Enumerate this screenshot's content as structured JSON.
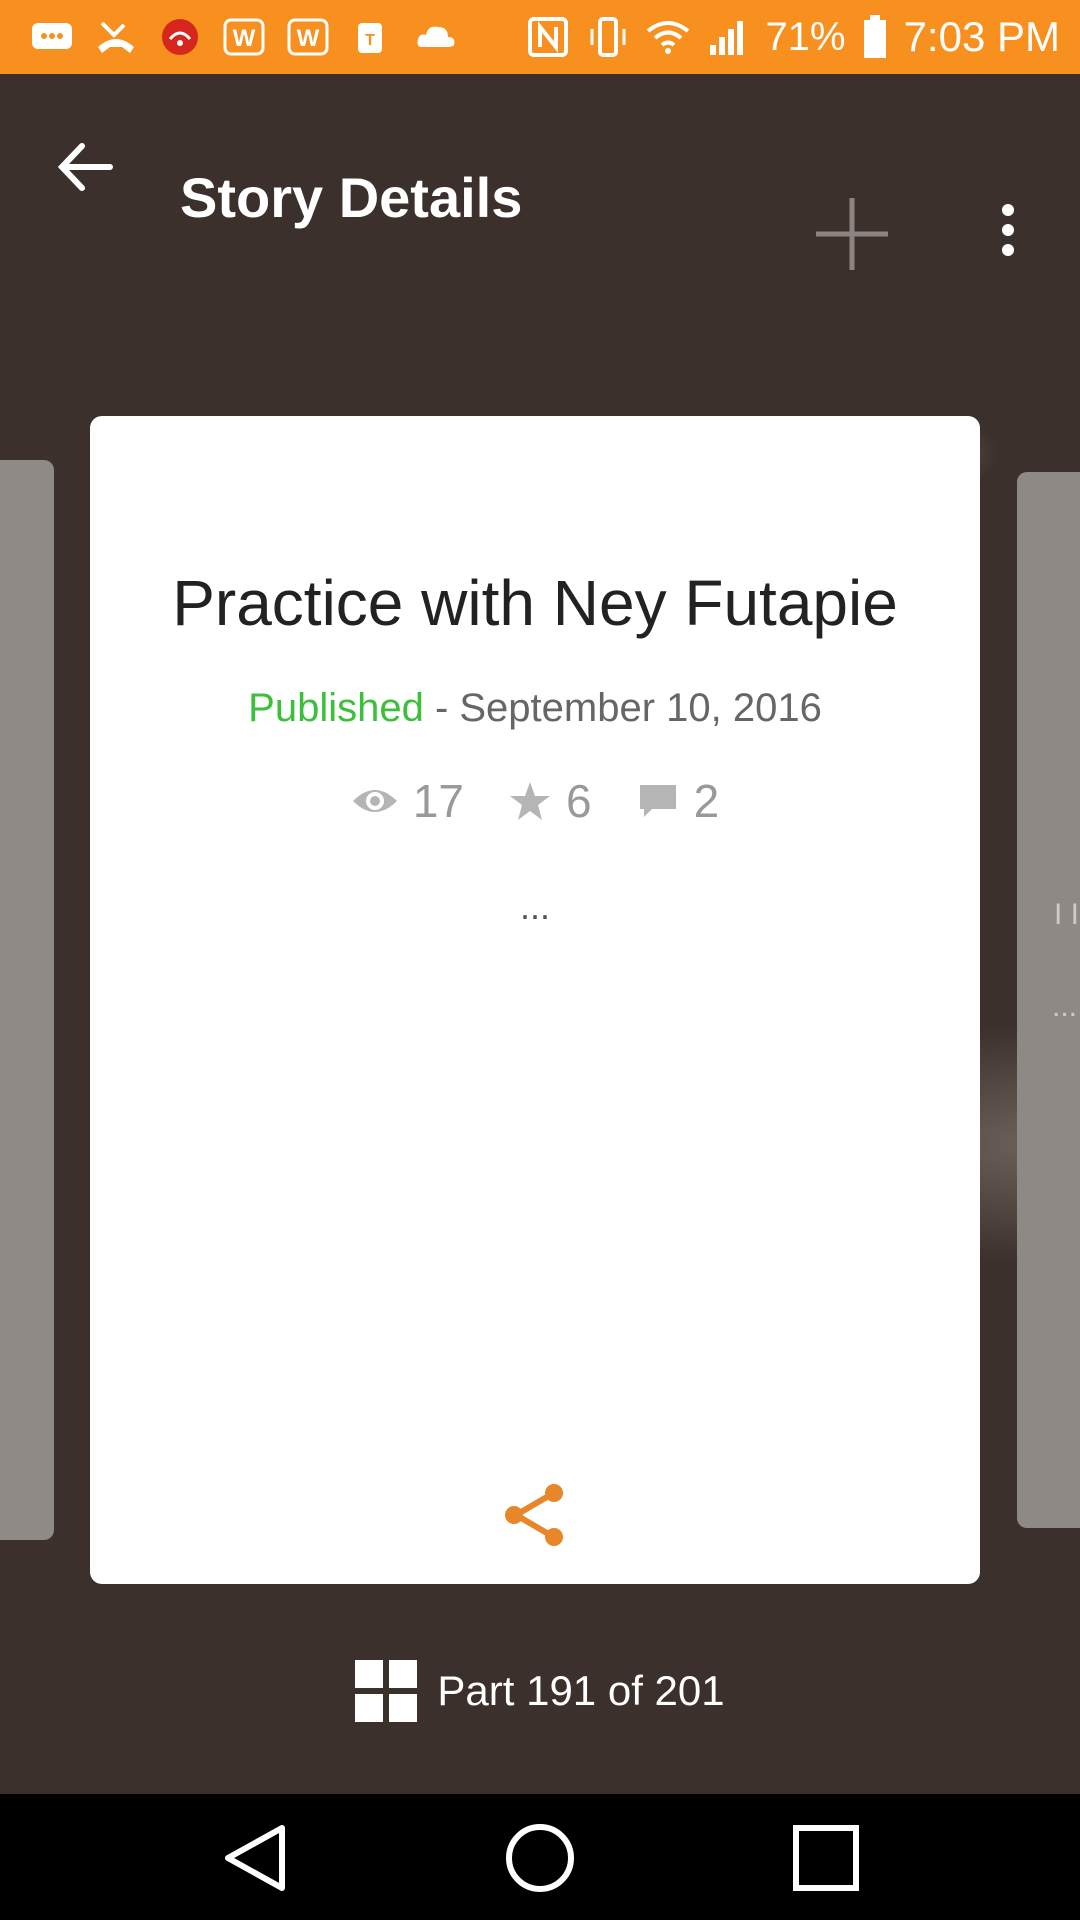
{
  "status_bar": {
    "battery": "71%",
    "time": "7:03 PM",
    "left_icons": [
      "messenger-icon",
      "missed-call-icon",
      "wifi-calling-icon",
      "word-icon",
      "word-icon-2",
      "tmobile-icon",
      "cloud-icon"
    ],
    "right_icons": [
      "nfc-icon",
      "vibrate-icon",
      "wifi-icon",
      "signal-icon",
      "battery-icon"
    ]
  },
  "app_bar": {
    "title": "Story Details",
    "back_icon": "arrow-back-icon",
    "add_icon": "plus-icon",
    "menu_icon": "more-vert-icon"
  },
  "story": {
    "title": "Practice with Ney Futapie",
    "status": "Published",
    "separator": " - ",
    "date": "September 10, 2016",
    "views": "17",
    "votes": "6",
    "comments": "2",
    "excerpt": "..."
  },
  "side_card": {
    "text": "I I",
    "excerpt": "..."
  },
  "part_indicator": {
    "label": "Part 191 of 201"
  },
  "colors": {
    "status_bar": "#f7901e",
    "published": "#3cc03c",
    "share": "#e8862a",
    "background": "#3b302b"
  }
}
